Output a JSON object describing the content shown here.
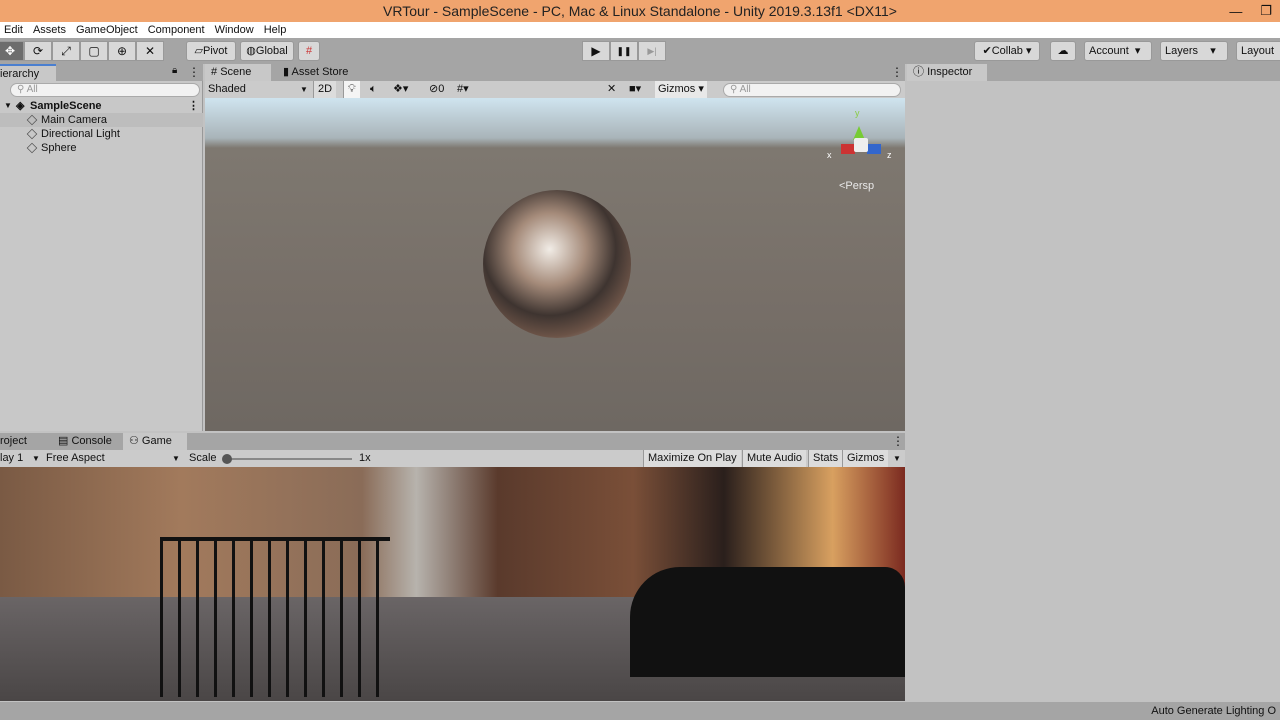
{
  "window": {
    "title": "VRTour - SampleScene - PC, Mac & Linux Standalone - Unity 2019.3.13f1 <DX11>",
    "minimize": "—",
    "maximize": "❐"
  },
  "menu": [
    "Edit",
    "Assets",
    "GameObject",
    "Component",
    "Window",
    "Help"
  ],
  "toolbar": {
    "pivot": "Pivot",
    "global": "Global",
    "collab": "Collab",
    "account": "Account",
    "layers": "Layers",
    "layout": "Layout",
    "play": "▶",
    "pause": "❚❚",
    "step": "▶|"
  },
  "hierarchy": {
    "tab": "ierarchy",
    "search": "All",
    "scene": "SampleScene",
    "items": [
      "Main Camera",
      "Directional Light",
      "Sphere"
    ]
  },
  "scene": {
    "tabs": [
      "Scene",
      "Asset Store"
    ],
    "shading": "Shaded",
    "mode2d": "2D",
    "hidden_count": "0",
    "gizmos": "Gizmos",
    "search": "All",
    "persp": "<Persp",
    "axis_x": "x",
    "axis_y": "y",
    "axis_z": "z"
  },
  "game": {
    "tabs": [
      "roject",
      "Console",
      "Game"
    ],
    "display": "lay 1",
    "aspect": "Free Aspect",
    "scale_label": "Scale",
    "scale_value": "1x",
    "buttons": [
      "Maximize On Play",
      "Mute Audio",
      "Stats",
      "Gizmos"
    ],
    "scale_fraction": 0
  },
  "inspector": {
    "tab": "Inspector"
  },
  "status": "Auto Generate Lighting O"
}
